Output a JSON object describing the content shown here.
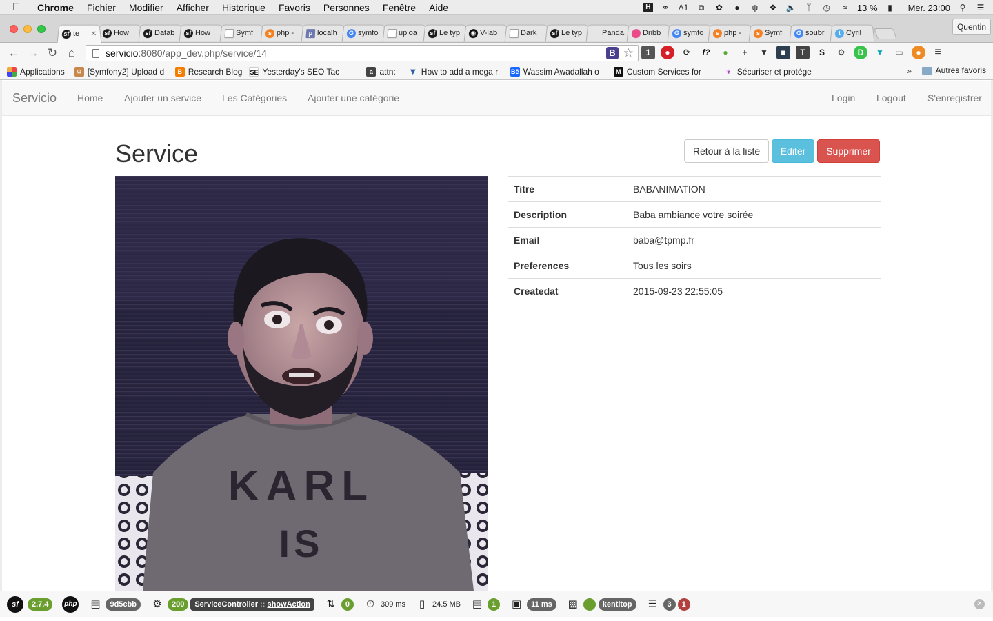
{
  "menubar": {
    "app": "Chrome",
    "items": [
      "Fichier",
      "Modifier",
      "Afficher",
      "Historique",
      "Favoris",
      "Personnes",
      "Fenêtre",
      "Aide"
    ],
    "battery": "13 %",
    "clock": "Mer. 23:00",
    "tray_number": "1"
  },
  "tabs": [
    {
      "label": "te",
      "active": true
    },
    {
      "label": "How"
    },
    {
      "label": "Datab"
    },
    {
      "label": "How"
    },
    {
      "label": "Symf"
    },
    {
      "label": "php -"
    },
    {
      "label": "localh"
    },
    {
      "label": "symfo"
    },
    {
      "label": "uploa"
    },
    {
      "label": "Le typ"
    },
    {
      "label": "V-lab"
    },
    {
      "label": "Dark"
    },
    {
      "label": "Le typ"
    },
    {
      "label": "Panda"
    },
    {
      "label": "Dribb"
    },
    {
      "label": "symfo"
    },
    {
      "label": "php -"
    },
    {
      "label": "Symf"
    },
    {
      "label": "soubr"
    },
    {
      "label": "Cyril"
    }
  ],
  "profile": "Quentin",
  "address": {
    "host": "servicio",
    "path": ":8080/app_dev.php/service/14"
  },
  "bookmarks": {
    "items": [
      {
        "label": "Applications"
      },
      {
        "label": "[Symfony2] Upload d"
      },
      {
        "label": "Research Blog"
      },
      {
        "label": "Yesterday's SEO Tac"
      },
      {
        "label": "attn:"
      },
      {
        "label": "How to add a mega r"
      },
      {
        "label": "Wassim Awadallah o"
      },
      {
        "label": "Custom Services for"
      },
      {
        "label": "Sécuriser et protége"
      }
    ],
    "more": "»",
    "other": "Autres favoris"
  },
  "app_nav": {
    "brand": "Servicio",
    "left_links": [
      "Home",
      "Ajouter un service",
      "Les Catégories",
      "Ajouter une catégorie"
    ],
    "right_links": [
      "Login",
      "Logout",
      "S'enregistrer"
    ]
  },
  "page": {
    "title": "Service",
    "buttons": {
      "back": "Retour à la liste",
      "edit": "Editer",
      "delete": "Supprimer"
    },
    "photo_text": [
      "KARL",
      "IS"
    ],
    "details": [
      {
        "label": "Titre",
        "value": "BABANIMATION"
      },
      {
        "label": "Description",
        "value": "Baba ambiance votre soirée"
      },
      {
        "label": "Email",
        "value": "baba@tpmp.fr"
      },
      {
        "label": "Preferences",
        "value": "Tous les soirs"
      },
      {
        "label": "Createdat",
        "value": "2015-09-23 22:55:05"
      }
    ]
  },
  "profiler": {
    "symfony_version": "2.7.4",
    "token": "9d5cbb",
    "status": "200",
    "controller": "ServiceController",
    "separator": "::",
    "action": "showAction",
    "ajax_count": "0",
    "time": "309 ms",
    "memory": "24.5 MB",
    "logs": "1",
    "twig_time": "11 ms",
    "user": "kentitop",
    "queries": "3",
    "query_errors": "1"
  }
}
